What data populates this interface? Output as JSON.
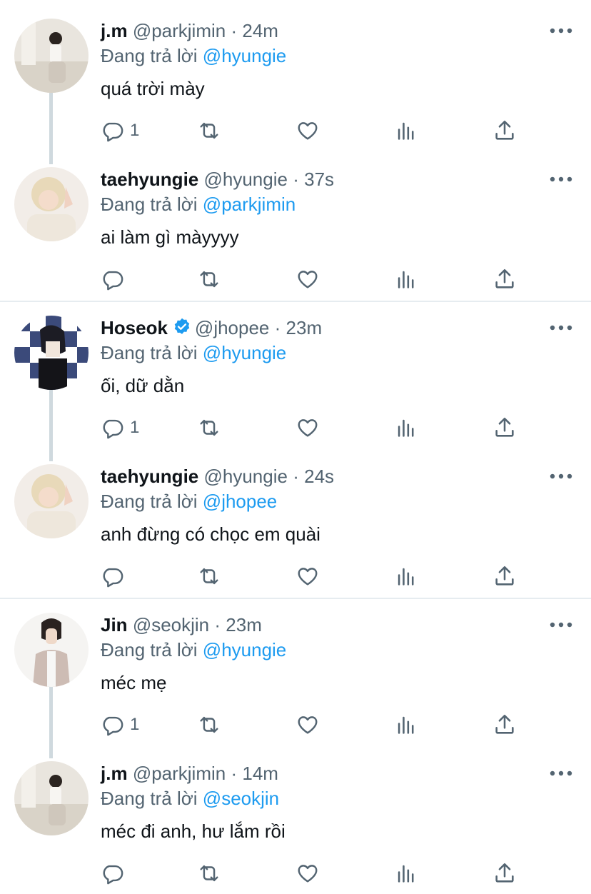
{
  "threads": [
    {
      "tweets": [
        {
          "name": "j.m",
          "handle": "@parkjimin",
          "time": "24m",
          "verified": false,
          "reply_prefix": "Đang trả lời",
          "reply_to": "@hyungie",
          "text": "quá trời mày",
          "reply_count": "1",
          "avatar": "jm"
        },
        {
          "name": "taehyungie",
          "handle": "@hyungie",
          "time": "37s",
          "verified": false,
          "reply_prefix": "Đang trả lời",
          "reply_to": "@parkjimin",
          "text": "ai làm gì màyyyy",
          "reply_count": "",
          "avatar": "tae"
        }
      ]
    },
    {
      "tweets": [
        {
          "name": "Hoseok",
          "handle": "@jhopee",
          "time": "23m",
          "verified": true,
          "reply_prefix": "Đang trả lời",
          "reply_to": "@hyungie",
          "text": "ối, dữ dằn",
          "reply_count": "1",
          "avatar": "hoseok"
        },
        {
          "name": "taehyungie",
          "handle": "@hyungie",
          "time": "24s",
          "verified": false,
          "reply_prefix": "Đang trả lời",
          "reply_to": "@jhopee",
          "text": "anh đừng có chọc em quài",
          "reply_count": "",
          "avatar": "tae"
        }
      ]
    },
    {
      "tweets": [
        {
          "name": "Jin",
          "handle": "@seokjin",
          "time": "23m",
          "verified": false,
          "reply_prefix": "Đang trả lời",
          "reply_to": "@hyungie",
          "text": "méc mẹ",
          "reply_count": "1",
          "avatar": "jin"
        },
        {
          "name": "j.m",
          "handle": "@parkjimin",
          "time": "14m",
          "verified": false,
          "reply_prefix": "Đang trả lời",
          "reply_to": "@seokjin",
          "text": "méc đi anh, hư lắm rồi",
          "reply_count": "",
          "avatar": "jm"
        }
      ]
    }
  ],
  "separator_dot": "·",
  "icons": {
    "more": "more-icon",
    "reply": "reply-icon",
    "retweet": "retweet-icon",
    "like": "heart-icon",
    "analytics": "analytics-icon",
    "share": "share-icon"
  },
  "colors": {
    "text": "#0f1419",
    "secondary": "#536471",
    "mention": "#1d9bf0",
    "verified": "#1d9bf0",
    "divider": "#e6ecf0",
    "thread_line": "#cfd9de"
  }
}
